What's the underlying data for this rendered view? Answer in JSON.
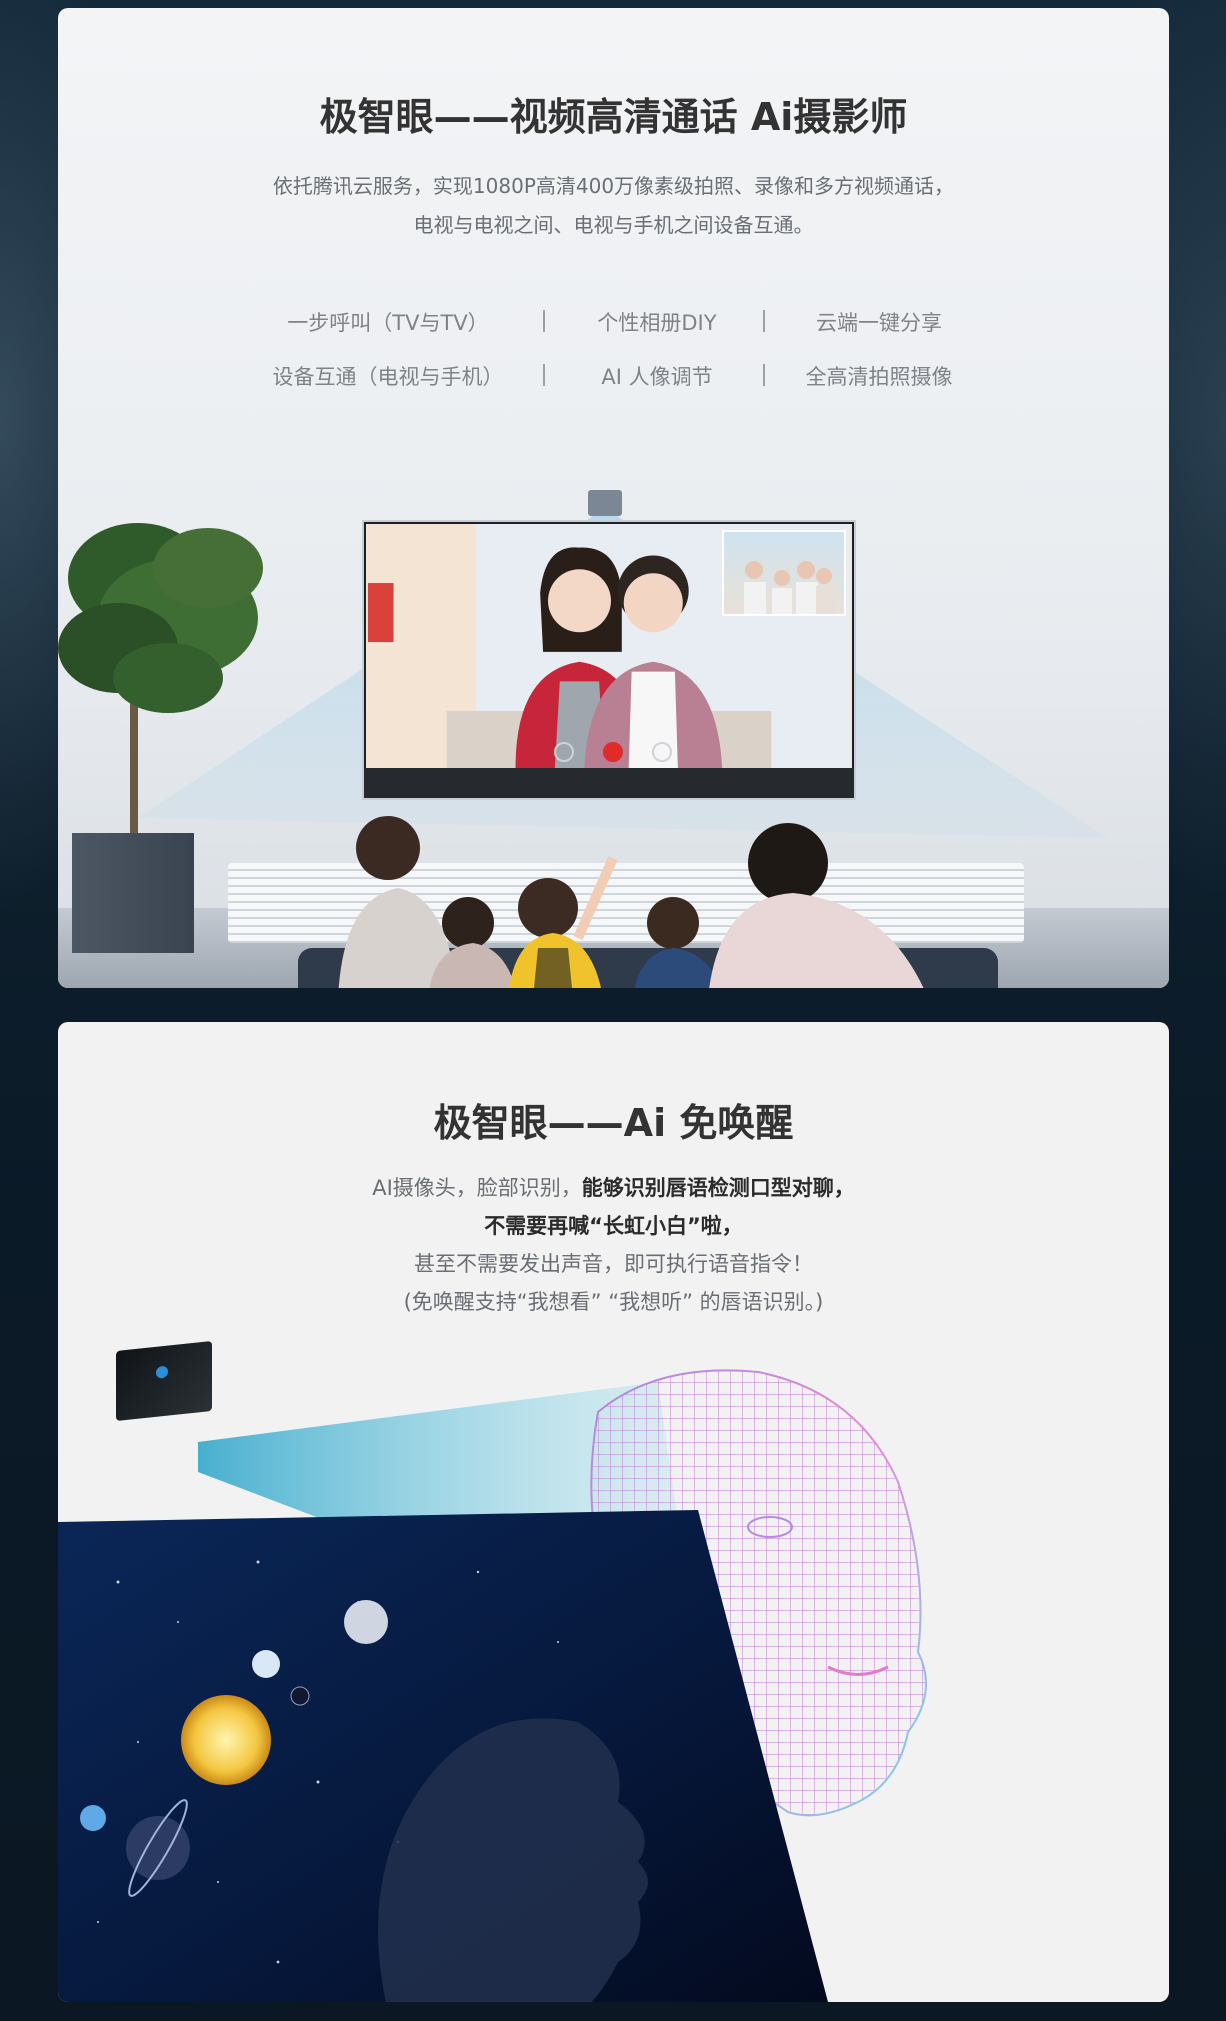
{
  "section1": {
    "title": "极智眼——视频高清通话 Ai摄影师",
    "desc_line1": "依托腾讯云服务，实现1080P高清400万像素级拍照、录像和多方视频通话，",
    "desc_line2": "电视与电视之间、电视与手机之间设备互通。",
    "features": [
      "一步呼叫（TV与TV）",
      "个性相册DIY",
      "云端一键分享",
      "设备互通（电视与手机）",
      "AI 人像调节",
      "全高清拍照摄像"
    ]
  },
  "section2": {
    "title": "极智眼——Ai 免唤醒",
    "line1_normal": "AI摄像头，脸部识别，",
    "line1_bold": "能够识别唇语检测口型对聊，",
    "line2_bold": "不需要再喊“长虹小白”啦，",
    "line3": "甚至不需要发出声音，即可执行语音指令！",
    "line4": "(免唤醒支持“我想看” “我想听” 的唇语识别。)"
  },
  "icons": {
    "call_forward": "forward-call-icon",
    "hang_up": "hang-up-icon",
    "camera": "camera-icon"
  },
  "colors": {
    "page_bg": "#0e2030",
    "title": "#333333",
    "text": "#6a6f75",
    "hangup": "#e02b2b",
    "beam": "#9fd3ea"
  }
}
